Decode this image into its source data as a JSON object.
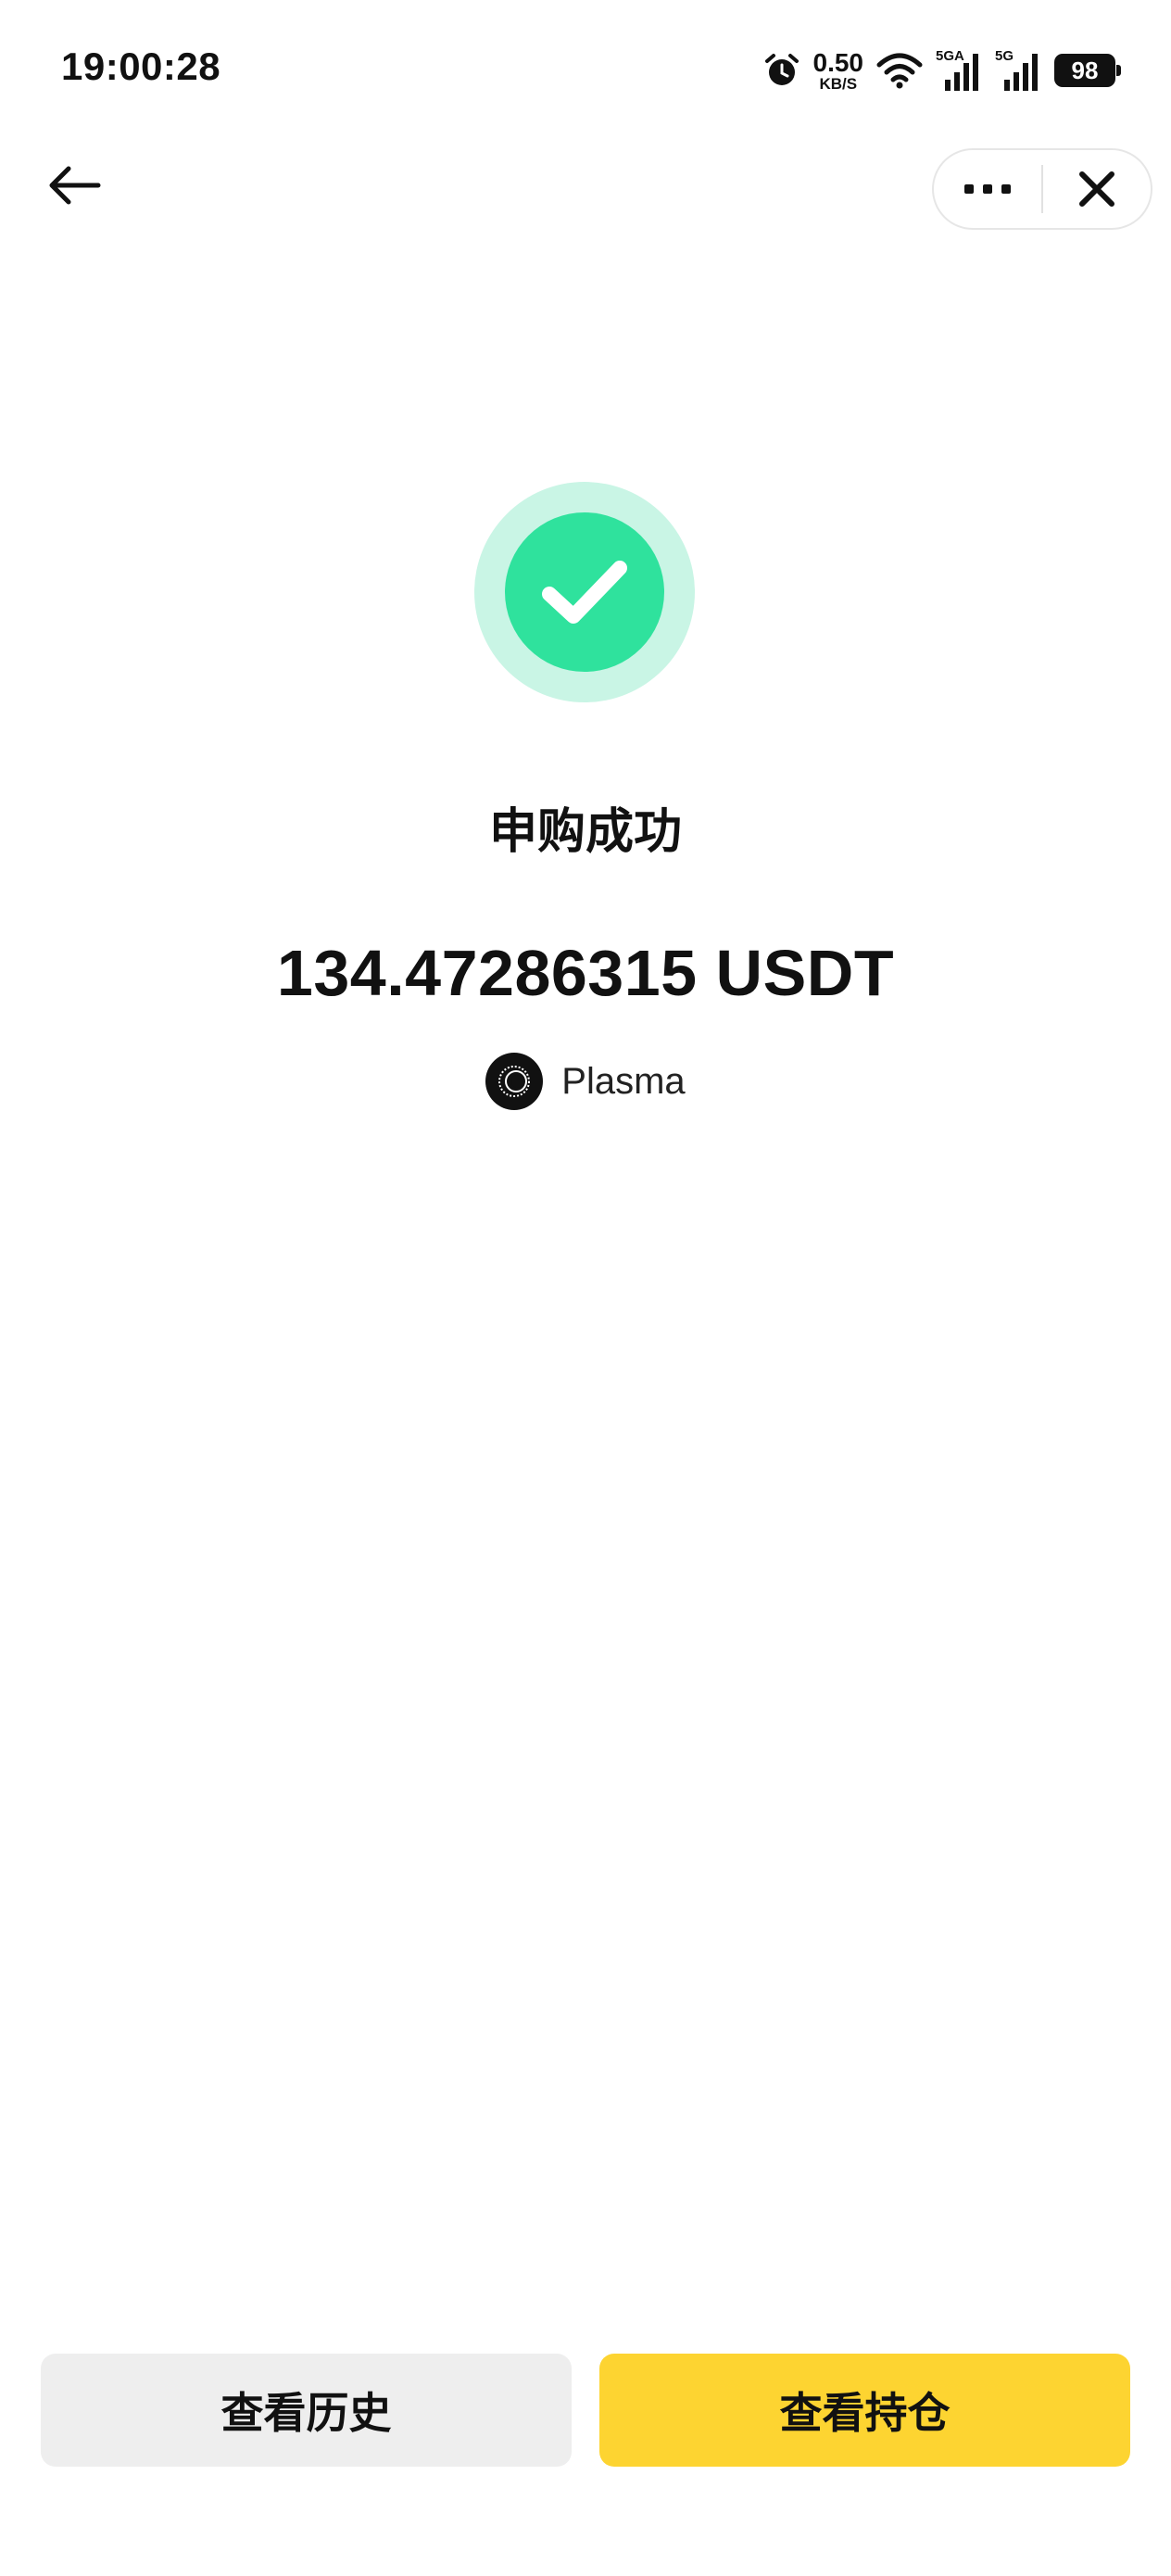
{
  "status_bar": {
    "time": "19:00:28",
    "net_speed_value": "0.50",
    "net_speed_unit": "KB/S",
    "signal1_label": "5GA",
    "signal2_label": "5G",
    "battery": "98"
  },
  "success": {
    "title": "申购成功",
    "amount": "134.47286315 USDT",
    "network": "Plasma",
    "accent_color": "#2fe29d"
  },
  "actions": {
    "history_label": "查看历史",
    "holdings_label": "查看持仓",
    "primary_color": "#fdd431"
  }
}
